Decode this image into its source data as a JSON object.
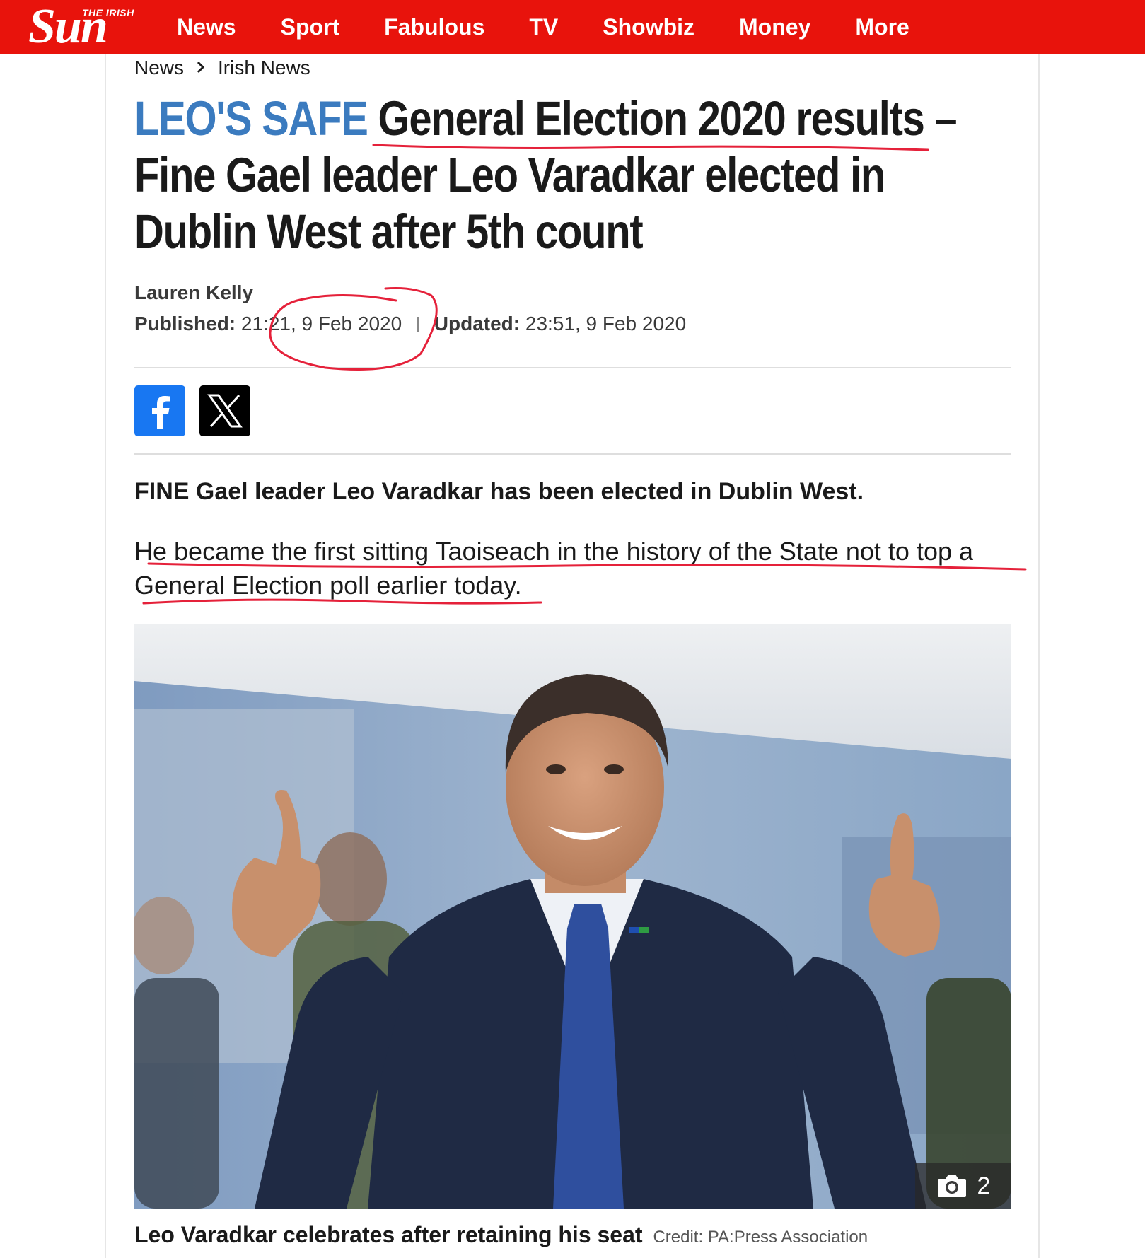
{
  "site": {
    "logo_small": "THE IRISH",
    "logo_big": "Sun"
  },
  "nav": {
    "items": [
      "News",
      "Sport",
      "Fabulous",
      "TV",
      "Showbiz",
      "Money",
      "More"
    ]
  },
  "breadcrumb": {
    "items": [
      "News",
      "Irish News"
    ]
  },
  "article": {
    "kicker": "LEO'S SAFE",
    "headline": "General Election 2020 results – Fine Gael leader Leo Varadkar elected in Dublin West after 5th count",
    "author": "Lauren Kelly",
    "published_label": "Published:",
    "published_value": "21:21, 9 Feb 2020",
    "updated_label": "Updated:",
    "updated_value": "23:51, 9 Feb 2020",
    "lede": "FINE Gael leader Leo Varadkar has been elected in Dublin West.",
    "paragraph": "He became the first sitting Taoiseach in the history of the State not to top a General Election poll earlier today.",
    "photo_count": "2",
    "caption": "Leo Varadkar celebrates after retaining his seat",
    "credit": "Credit: PA:Press Association"
  },
  "icons": {
    "facebook": "facebook-icon",
    "x": "x-icon",
    "camera": "camera-icon",
    "chevron": "chevron-right-icon"
  },
  "colors": {
    "brand_red": "#e8130c",
    "kicker_blue": "#3b7bbf",
    "facebook_blue": "#1877f2",
    "annotation_red": "#e5213a"
  }
}
